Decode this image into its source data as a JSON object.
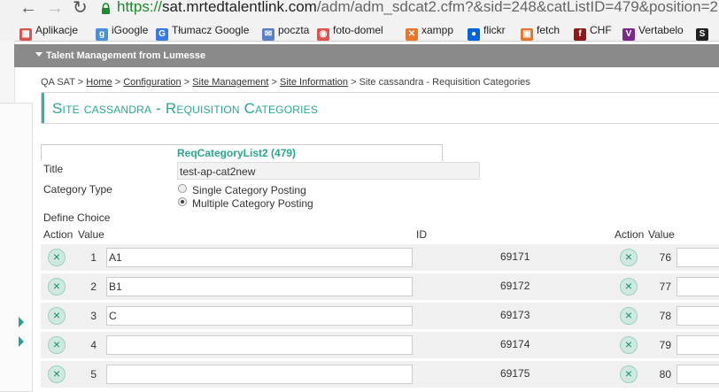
{
  "browser": {
    "url_scheme": "https://",
    "url_domain": "sat.mrtedtalentlink.com",
    "url_path": "/adm/adm_sdcat2.cfm?&sid=248&catListID=479&position=2",
    "bookmarks": [
      {
        "label": "Aplikacje",
        "icon": "apps-grid-icon",
        "color": "#d9534f"
      },
      {
        "label": "iGoogle",
        "icon": "igoogle-icon",
        "color": "#4a90d9"
      },
      {
        "label": "Tłumacz Google",
        "icon": "translate-icon",
        "color": "#3b78e7"
      },
      {
        "label": "poczta",
        "icon": "mail-icon",
        "color": "#5b7fc4"
      },
      {
        "label": "foto-domel",
        "icon": "photo-icon",
        "color": "#e05353"
      },
      {
        "label": "xampp",
        "icon": "xampp-icon",
        "color": "#e8772e"
      },
      {
        "label": "flickr",
        "icon": "flickr-icon",
        "color": "#0063dc"
      },
      {
        "label": "fetch",
        "icon": "fetch-icon",
        "color": "#e8772e"
      },
      {
        "label": "CHF",
        "icon": "chf-icon",
        "color": "#8b1a1a"
      },
      {
        "label": "Vertabelo",
        "icon": "vertabelo-icon",
        "color": "#7a2a8a"
      },
      {
        "label": "",
        "icon": "sw-icon",
        "color": "#222"
      }
    ]
  },
  "app": {
    "header_title": "Talent Management from Lumesse"
  },
  "breadcrumb": {
    "root": "QA SAT",
    "sep": ">",
    "links": [
      "Home",
      "Configuration",
      "Site Management",
      "Site Information"
    ],
    "current": "Site cassandra - Requisition Categories"
  },
  "page": {
    "title": "Site cassandra - Requisition Categories",
    "list_name": "ReqCategoryList2 (479)"
  },
  "form": {
    "title_label": "Title",
    "title_value": "test-ap-cat2new",
    "category_type_label": "Category Type",
    "option_single": "Single Category Posting",
    "option_multiple": "Multiple Category Posting",
    "selected_option": "multiple",
    "define_choice_label": "Define Choice"
  },
  "table": {
    "col_action": "Action",
    "col_value": "Value",
    "col_id": "ID",
    "col_action2": "Action",
    "col_value2": "Value",
    "remove_symbol": "×",
    "rows": [
      {
        "num": "1",
        "value": "A1",
        "id": "69171",
        "num2": "76"
      },
      {
        "num": "2",
        "value": "B1",
        "id": "69172",
        "num2": "77"
      },
      {
        "num": "3",
        "value": "C",
        "id": "69173",
        "num2": "78"
      },
      {
        "num": "4",
        "value": "",
        "id": "69174",
        "num2": "79"
      },
      {
        "num": "5",
        "value": "",
        "id": "69175",
        "num2": "80"
      }
    ]
  }
}
